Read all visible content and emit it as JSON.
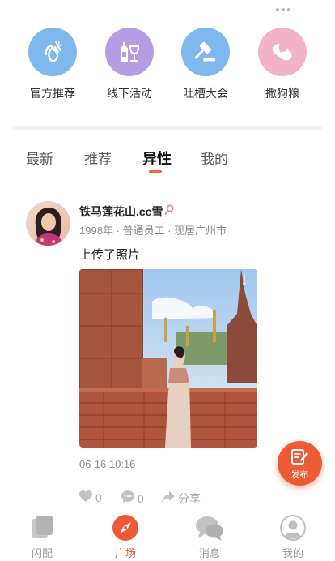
{
  "quick_actions": [
    {
      "label": "官方推荐",
      "icon": "clapping-hands-icon",
      "color": "#7fb8ec"
    },
    {
      "label": "线下活动",
      "icon": "wine-glass-icon",
      "color": "#b59de3"
    },
    {
      "label": "吐槽大会",
      "icon": "gavel-icon",
      "color": "#7fb8ec"
    },
    {
      "label": "撒狗粮",
      "icon": "pill-heart-icon",
      "color": "#f2b3c6"
    }
  ],
  "tabs": [
    "最新",
    "推荐",
    "异性",
    "我的"
  ],
  "active_tab": "异性",
  "post": {
    "username": "铁马莲花山.cc雪",
    "meta": "1998年 · 普通员工 · 现居广州市",
    "text": "上传了照片",
    "time": "06-16 10:16",
    "like_count": "0",
    "comment_count": "0",
    "share_label": "分享"
  },
  "fab": {
    "label": "发布",
    "color": "#ec5a36"
  },
  "bottom_nav": [
    {
      "label": "闪配",
      "icon": "cards-icon"
    },
    {
      "label": "广场",
      "icon": "compass-icon"
    },
    {
      "label": "消息",
      "icon": "chat-bubbles-icon"
    },
    {
      "label": "我的",
      "icon": "profile-icon"
    }
  ],
  "active_nav": "广场",
  "colors": {
    "accent": "#ec5a36",
    "muted": "#a8a8a8"
  }
}
